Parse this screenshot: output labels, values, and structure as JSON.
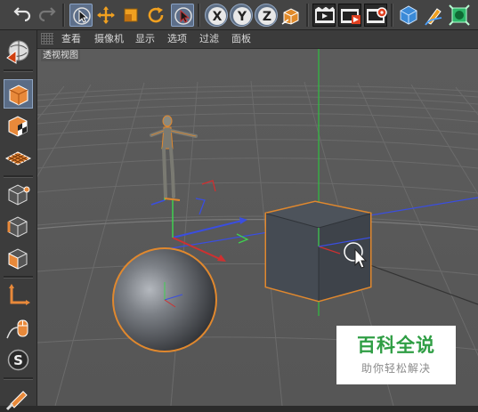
{
  "viewport": {
    "menu": [
      "查看",
      "摄像机",
      "显示",
      "选项",
      "过滤",
      "面板"
    ],
    "view_label": "透视视图"
  },
  "watermark": {
    "title": "百科全说",
    "subtitle": "助你轻松解决"
  },
  "colors": {
    "viewport_bg": "#5a5a5a",
    "selection_orange": "#e0882e",
    "axis_x": "#e03030",
    "axis_y": "#30c040",
    "axis_z": "#3050e0",
    "watermark_green": "#2f9e44"
  },
  "toolbar_icons": [
    "undo-icon",
    "redo-icon",
    "live-select-icon",
    "move-icon",
    "scale-icon",
    "rotate-icon",
    "recent-tool-icon",
    "x-axis-lock-icon",
    "y-axis-lock-icon",
    "z-axis-lock-icon",
    "coordinate-system-icon",
    "render-view-icon",
    "render-picture-viewer-icon",
    "render-settings-icon",
    "cube-icon",
    "pen-icon",
    "deformer-icon"
  ],
  "sidebar_icons": [
    "model-mode-icon",
    "object-mode-icon",
    "texture-mode-icon",
    "workplane-icon",
    "points-mode-icon",
    "edges-mode-icon",
    "polygons-mode-icon",
    "axis-mode-icon",
    "tweak-mode-icon",
    "snap-icon",
    "paint-icon"
  ]
}
